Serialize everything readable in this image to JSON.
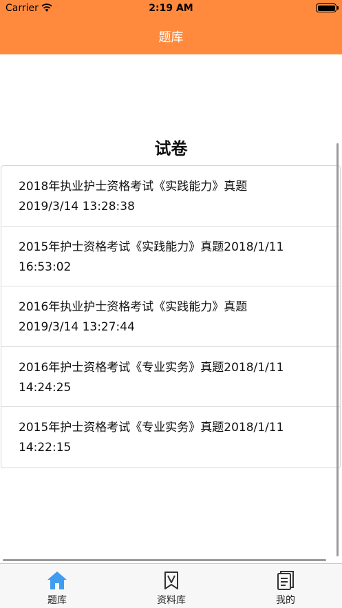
{
  "status_bar": {
    "carrier": "Carrier",
    "time": "2:19 AM"
  },
  "nav": {
    "title": "题库"
  },
  "section": {
    "title": "试卷"
  },
  "papers": [
    {
      "title": "2018年执业护士资格考试《实践能力》真题",
      "time": "2019/3/14 13:28:38"
    },
    {
      "title": "2015年护士资格考试《实践能力》真题",
      "time": "2018/1/11 16:53:02"
    },
    {
      "title": "2016年执业护士资格考试《实践能力》真题",
      "time": "2019/3/14 13:27:44"
    },
    {
      "title": "2016年护士资格考试《专业实务》真题",
      "time": "2018/1/11 14:24:25"
    },
    {
      "title": "2015年护士资格考试《专业实务》真题",
      "time": "2018/1/11 14:22:15"
    }
  ],
  "tabs": [
    {
      "label": "题库",
      "icon": "home-icon",
      "active": true
    },
    {
      "label": "资料库",
      "icon": "bookmark-book-icon",
      "active": false
    },
    {
      "label": "我的",
      "icon": "document-icon",
      "active": false
    }
  ],
  "colors": {
    "accent": "#ff8a3d",
    "tab_active": "#3f9cf0",
    "tab_inactive": "#333333"
  }
}
